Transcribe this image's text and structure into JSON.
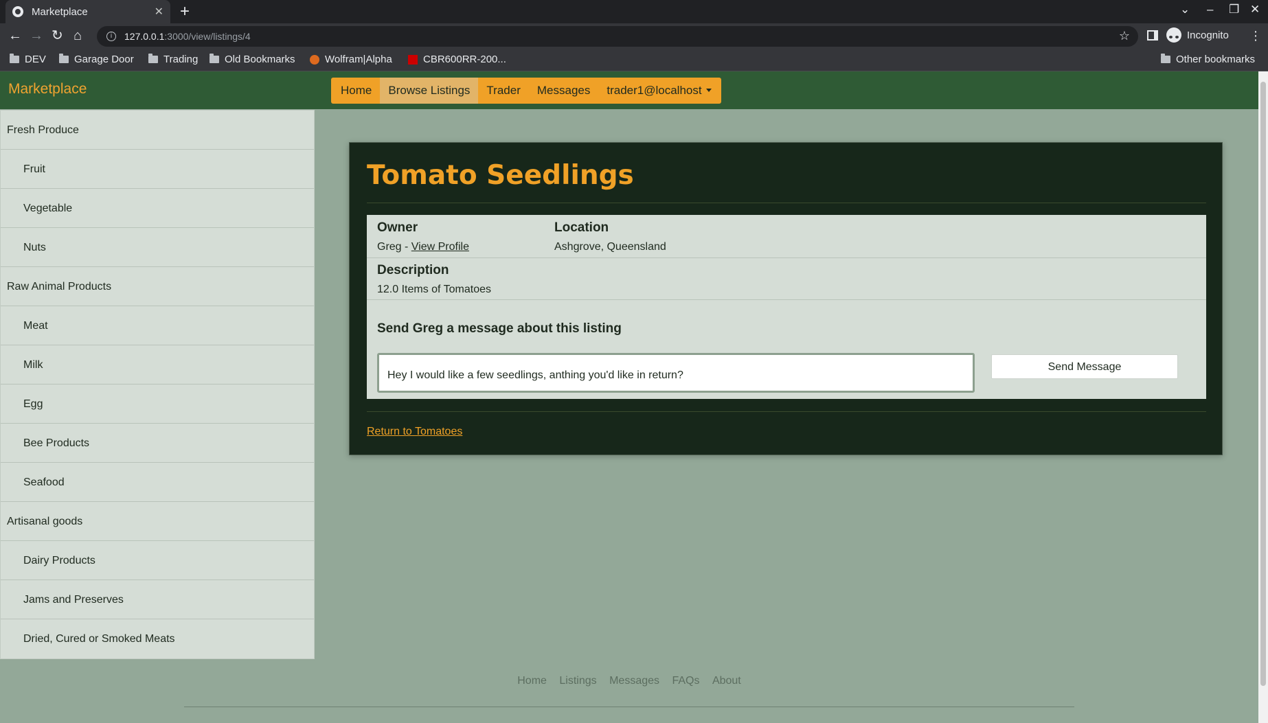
{
  "browser": {
    "tab_title": "Marketplace",
    "url_host": "127.0.0.1",
    "url_path": ":3000/view/listings/4",
    "profile_label": "Incognito",
    "bookmarks": [
      "DEV",
      "Garage Door",
      "Trading",
      "Old Bookmarks",
      "Wolfram|Alpha",
      "CBR600RR-200..."
    ],
    "other_bookmarks": "Other bookmarks"
  },
  "site": {
    "brand": "Marketplace",
    "nav": [
      "Home",
      "Browse Listings",
      "Trader",
      "Messages",
      "trader1@localhost"
    ],
    "active_nav": "Browse Listings"
  },
  "sidebar": {
    "categories": [
      {
        "label": "Fresh Produce",
        "level": 0
      },
      {
        "label": "Fruit",
        "level": 1
      },
      {
        "label": "Vegetable",
        "level": 1
      },
      {
        "label": "Nuts",
        "level": 1
      },
      {
        "label": "Raw Animal Products",
        "level": 0
      },
      {
        "label": "Meat",
        "level": 1
      },
      {
        "label": "Milk",
        "level": 1
      },
      {
        "label": "Egg",
        "level": 1
      },
      {
        "label": "Bee Products",
        "level": 1
      },
      {
        "label": "Seafood",
        "level": 1
      },
      {
        "label": "Artisanal goods",
        "level": 0
      },
      {
        "label": "Dairy Products",
        "level": 1
      },
      {
        "label": "Jams and Preserves",
        "level": 1
      },
      {
        "label": "Dried, Cured or Smoked Meats",
        "level": 1
      }
    ]
  },
  "listing": {
    "title": "Tomato Seedlings",
    "owner_heading": "Owner",
    "owner_name": "Greg -",
    "view_profile": "View Profile",
    "location_heading": "Location",
    "location": "Ashgrove, Queensland",
    "description_heading": "Description",
    "description": "12.0 Items of Tomatoes",
    "message_heading": "Send Greg a message about this listing",
    "message_value": "Hey I would like a few seedlings, anthing you'd like in return?",
    "send_label": "Send Message",
    "return_link": "Return to Tomatoes"
  },
  "footer": {
    "links": [
      "Home",
      "Listings",
      "Messages",
      "FAQs",
      "About"
    ]
  },
  "colors": {
    "nav_green": "#2f5b35",
    "accent_orange": "#f0a127",
    "card_dark": "#17271a",
    "page_bg": "#93a898"
  }
}
